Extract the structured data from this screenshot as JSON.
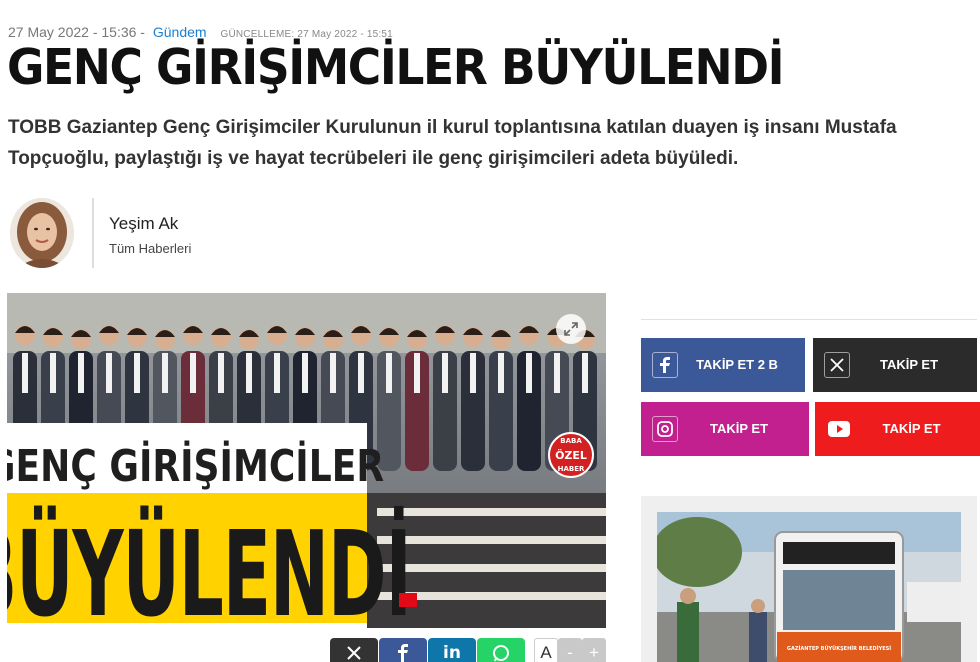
{
  "meta": {
    "date": "27 May 2022 - 15:36 -",
    "category": "Gündem",
    "updated": "GÜNCELLEME: 27 May 2022 - 15:51"
  },
  "article": {
    "title": "GENÇ GİRİŞİMCİLER BÜYÜLENDİ",
    "summary": "TOBB Gaziantep Genç Girişimciler Kurulunun il kurul toplantısına katılan duayen iş insanı Mustafa Topçuoğlu, paylaştığı iş ve hayat tecrübeleri ile genç girişimcileri adeta büyüledi.",
    "image_text_line1": "GENÇ GİRİŞİMCİLER",
    "image_text_line2": "BÜYÜLENDİ",
    "badge_text": [
      "BABA",
      "ÖZEL",
      "HABER"
    ]
  },
  "author": {
    "name": "Yeşim Ak",
    "all_news": "Tüm Haberleri"
  },
  "share": {
    "buttons": [
      "x-icon",
      "facebook-icon",
      "linkedin-icon",
      "whatsapp-icon"
    ],
    "font_controls": [
      "A",
      "-",
      "+"
    ]
  },
  "social": [
    {
      "name": "facebook",
      "label": "TAKİP ET 2 B",
      "color": "#3b5998",
      "icon": "facebook-icon"
    },
    {
      "name": "x",
      "label": "TAKİP ET",
      "color": "#2b2b2b",
      "icon": "x-icon"
    },
    {
      "name": "instagram",
      "label": "TAKİP ET",
      "color": "#c1208e",
      "icon": "instagram-icon"
    },
    {
      "name": "youtube",
      "label": "TAKİP ET",
      "color": "#ee1c1c",
      "icon": "youtube-icon"
    }
  ],
  "ad": {
    "bus_sign": "GAZİANTEP BÜYÜKŞEHİR BELEDİYESİ"
  },
  "colors": {
    "accent": "#1a7fd0",
    "share_x": "#333333",
    "share_facebook": "#3b5998",
    "share_linkedin": "#0e76a8",
    "share_whatsapp": "#25d366"
  }
}
